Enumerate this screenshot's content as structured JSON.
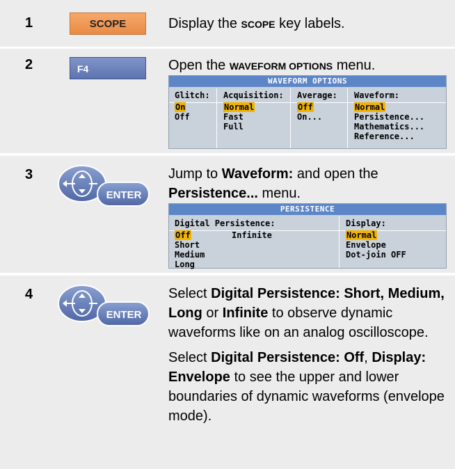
{
  "steps": [
    {
      "number": "1",
      "key_label": "SCOPE",
      "desc_pre": "Display the ",
      "desc_key": "SCOPE",
      "desc_post": " key labels."
    },
    {
      "number": "2",
      "key_label": "F4",
      "desc_pre": "Open the ",
      "desc_key": "WAVEFORM OPTIONS",
      "desc_post": " menu.",
      "menu": {
        "title": "WAVEFORM OPTIONS",
        "columns": [
          {
            "header": "Glitch:",
            "options": [
              "On",
              "Off"
            ],
            "selected": "On"
          },
          {
            "header": "Acquisition:",
            "options": [
              "Normal",
              "Fast",
              "Full"
            ],
            "selected": "Normal"
          },
          {
            "header": "Average:",
            "options": [
              "Off",
              "On..."
            ],
            "selected": "Off"
          },
          {
            "header": "Waveform:",
            "options": [
              "Normal",
              "Persistence...",
              "Mathematics...",
              "Reference..."
            ],
            "selected": "Normal"
          }
        ]
      }
    },
    {
      "number": "3",
      "key_label": "ENTER",
      "desc_parts": [
        "Jump to ",
        "Waveform:",
        " and open the ",
        "Persistence...",
        " menu."
      ],
      "menu": {
        "title": "PERSISTENCE",
        "digital_header": "Digital Persistence:",
        "digital_options": [
          "Off",
          "Short",
          "Medium",
          "Long"
        ],
        "digital_selected": "Off",
        "infinite": "Infinite",
        "display_header": "Display:",
        "display_options": [
          "Normal",
          "Envelope",
          "Dot-join OFF"
        ],
        "display_selected": "Normal"
      }
    },
    {
      "number": "4",
      "key_label": "ENTER",
      "para1": [
        "Select ",
        "Digital Persistence: Short, Medium, Long",
        " or ",
        "Infinite",
        " to observe dynamic waveforms like on an analog oscilloscope."
      ],
      "para2": [
        "Select ",
        "Digital Persistence: Off",
        ", ",
        "Display: Envelope",
        " to see the upper and lower boundaries of dynamic waveforms (envelope mode)."
      ]
    }
  ]
}
